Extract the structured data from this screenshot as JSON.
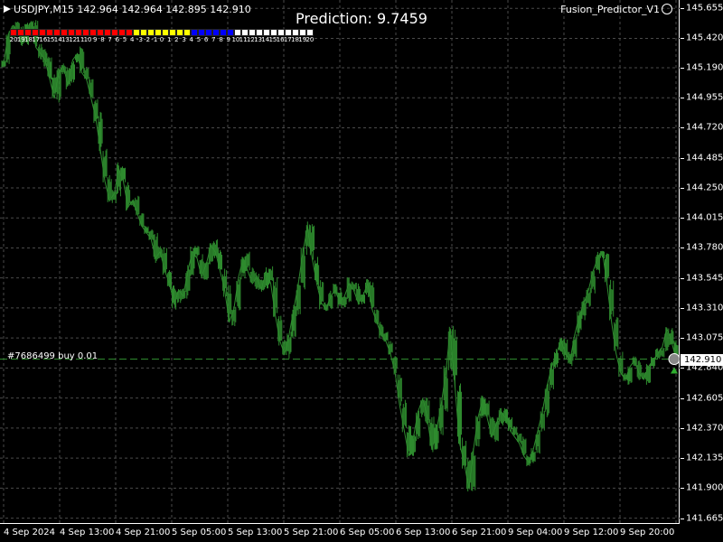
{
  "header": {
    "symbol_info": "USDJPY,M15  142.964 142.964 142.895 142.910",
    "prediction": "Prediction: 9.7459",
    "indicator_name": "Fusion_Predictor_V1"
  },
  "order": {
    "label": "#7686499 buy 0.01",
    "price": "142.910"
  },
  "heat_strip": {
    "labels": [
      "20",
      "19",
      "18",
      "17",
      "16",
      "15",
      "14",
      "13",
      "12",
      "11",
      "10",
      "9",
      "8",
      "7",
      "6",
      "5",
      "4",
      "-3",
      "-2",
      "-1",
      "0",
      "1",
      "2",
      "3",
      "4",
      "5",
      "6",
      "7",
      "8",
      "9",
      "10",
      "11",
      "12",
      "13",
      "14",
      "15",
      "16",
      "17",
      "18",
      "19",
      "20"
    ],
    "colors": [
      "#ff0000",
      "#ff0000",
      "#ff0000",
      "#ff0000",
      "#ff0000",
      "#ff0000",
      "#ff0000",
      "#ff0000",
      "#ff0000",
      "#ff0000",
      "#ff0000",
      "#ff0000",
      "#ff0000",
      "#ff0000",
      "#ff0000",
      "#ff0000",
      "#ff0000",
      "#ffff00",
      "#ffff00",
      "#ffff00",
      "#ffff00",
      "#ffff00",
      "#ffff00",
      "#ffff00",
      "#ffff00",
      "#0000ff",
      "#0000ff",
      "#0000ff",
      "#0000ff",
      "#0000ff",
      "#0000ff",
      "#ffffff",
      "#ffffff",
      "#ffffff",
      "#ffffff",
      "#ffffff",
      "#ffffff",
      "#ffffff",
      "#ffffff",
      "#ffffff",
      "#ffffff",
      "#ffffff"
    ]
  },
  "colors": {
    "candle": "#2e8b2e",
    "grid": "#4a4a4a",
    "order_line": "#2e8b2e",
    "background": "#000000"
  },
  "chart_data": {
    "type": "line",
    "title": "",
    "symbol": "USDJPY",
    "timeframe": "M15",
    "y_ticks": [
      "145.655",
      "145.420",
      "145.190",
      "144.955",
      "144.720",
      "144.485",
      "144.250",
      "144.015",
      "143.780",
      "143.545",
      "143.310",
      "143.075",
      "142.840",
      "142.605",
      "142.370",
      "142.135",
      "141.900",
      "141.665"
    ],
    "x_ticks": [
      "4 Sep 2024",
      "4 Sep 13:00",
      "4 Sep 21:00",
      "5 Sep 05:00",
      "5 Sep 13:00",
      "5 Sep 21:00",
      "6 Sep 05:00",
      "6 Sep 13:00",
      "6 Sep 21:00",
      "9 Sep 04:00",
      "9 Sep 12:00",
      "9 Sep 20:00"
    ],
    "ylim": [
      141.62,
      145.72
    ],
    "current_price": 142.91,
    "grid": true,
    "series": [
      {
        "values": [
          145.22,
          145.45,
          145.52,
          145.48,
          145.38,
          145.5,
          145.55,
          145.35,
          145.3,
          145.25,
          145.1,
          144.95,
          145.15,
          145.2,
          145.05,
          145.25,
          145.3,
          145.15,
          145.1,
          144.95,
          144.8,
          144.55,
          144.3,
          144.15,
          144.2,
          144.4,
          144.3,
          144.1,
          144.15,
          144.05,
          143.95,
          143.9,
          143.85,
          143.7,
          143.75,
          143.6,
          143.5,
          143.35,
          143.45,
          143.4,
          143.6,
          143.75,
          143.7,
          143.55,
          143.65,
          143.8,
          143.75,
          143.6,
          143.45,
          143.2,
          143.3,
          143.55,
          143.7,
          143.6,
          143.5,
          143.55,
          143.45,
          143.6,
          143.5,
          143.25,
          143.05,
          142.95,
          143.1,
          143.3,
          143.5,
          143.75,
          143.95,
          143.7,
          143.5,
          143.35,
          143.3,
          143.4,
          143.45,
          143.35,
          143.4,
          143.5,
          143.45,
          143.35,
          143.4,
          143.5,
          143.3,
          143.2,
          143.1,
          143.05,
          142.95,
          142.8,
          142.55,
          142.35,
          142.15,
          142.3,
          142.5,
          142.6,
          142.45,
          142.2,
          142.35,
          142.55,
          142.8,
          143.15,
          142.7,
          142.25,
          142.1,
          141.9,
          142.2,
          142.45,
          142.6,
          142.45,
          142.3,
          142.4,
          142.5,
          142.45,
          142.35,
          142.3,
          142.25,
          142.15,
          142.1,
          142.2,
          142.35,
          142.5,
          142.7,
          142.85,
          142.95,
          143.05,
          142.95,
          142.9,
          143.1,
          143.25,
          143.35,
          143.45,
          143.6,
          143.7,
          143.75,
          143.5,
          143.2,
          142.95,
          142.8,
          142.75,
          142.85,
          142.9,
          142.8,
          142.75,
          142.85,
          142.9,
          142.95,
          143.0,
          143.15,
          143.05,
          142.91
        ]
      }
    ]
  }
}
